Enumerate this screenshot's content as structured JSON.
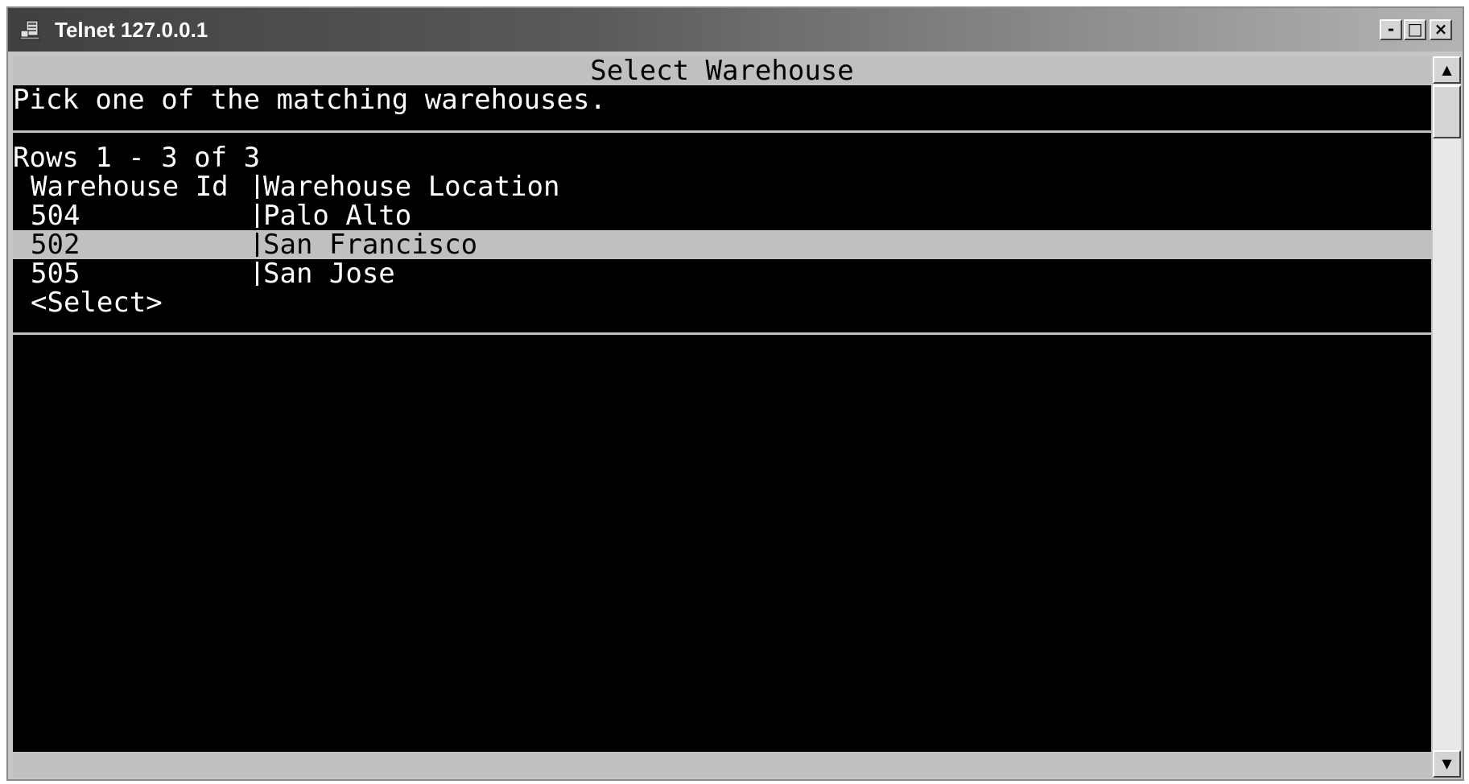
{
  "window": {
    "title": "Telnet 127.0.0.1",
    "minimize_glyph": "-",
    "maximize_glyph": "□",
    "close_glyph": "×"
  },
  "screen": {
    "header": "Select Warehouse",
    "instruction": "Pick one of the matching warehouses.",
    "row_count": "Rows 1 - 3 of 3",
    "columns": [
      "Warehouse Id",
      "Warehouse Location"
    ],
    "rows": [
      {
        "id": "504",
        "location": "Palo Alto",
        "selected": false
      },
      {
        "id": "502",
        "location": "San Francisco",
        "selected": true
      },
      {
        "id": "505",
        "location": "San Jose",
        "selected": false
      }
    ],
    "select_action": "<Select>"
  },
  "scrollbar": {
    "up_glyph": "▲",
    "down_glyph": "▼"
  },
  "colors": {
    "terminal_bg": "#000000",
    "terminal_fg": "#ffffff",
    "highlight_bg": "#c0c0c0"
  },
  "icons": {
    "app": "telnet-computer-icon"
  }
}
